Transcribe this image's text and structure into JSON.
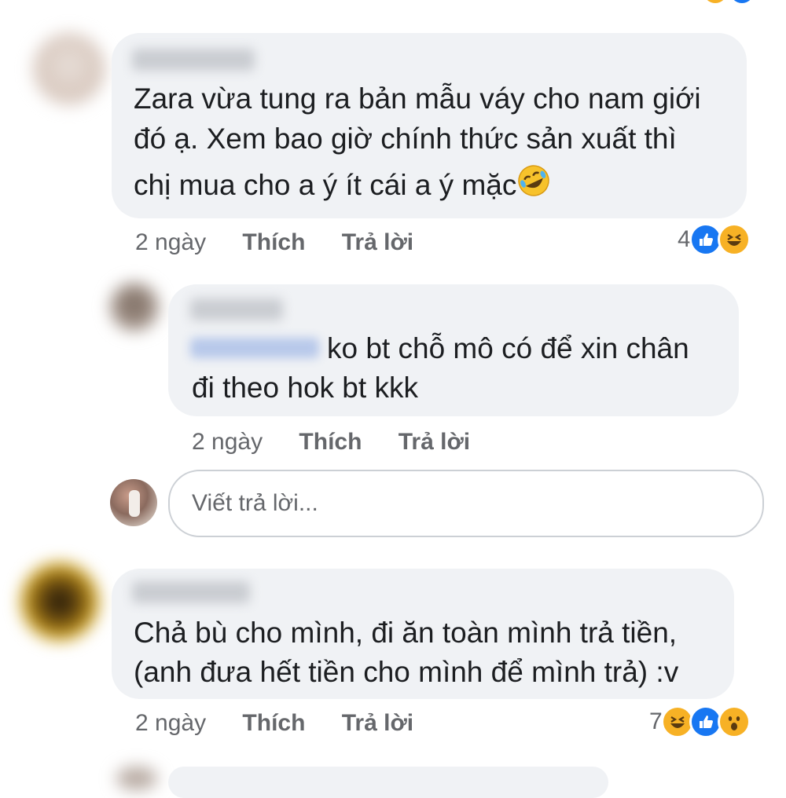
{
  "comments": [
    {
      "text_lines": [
        "Zara vừa tung ra bản mẫu váy cho nam giới",
        "đó ạ. Xem bao giờ chính thức sản xuất thì",
        "chị mua cho a ý ít cái a ý mặc"
      ],
      "emoji": "rolling-on-floor-laughing",
      "time": "2 ngày",
      "like_label": "Thích",
      "reply_label": "Trả lời",
      "reaction_count": "4",
      "reactions": [
        "like",
        "haha"
      ]
    },
    {
      "text_lines": [
        "ko bt chỗ mô có để xin chân",
        "đi theo hok bt kkk"
      ],
      "time": "2 ngày",
      "like_label": "Thích",
      "reply_label": "Trả lời"
    },
    {
      "text_lines": [
        "Chả bù cho mình, đi ăn toàn mình trả tiền,",
        "(anh đưa hết tiền cho mình để mình trả) :v"
      ],
      "time": "2 ngày",
      "like_label": "Thích",
      "reply_label": "Trả lời",
      "reaction_count": "7",
      "reactions": [
        "haha",
        "like",
        "wow"
      ]
    }
  ],
  "reply_box": {
    "placeholder": "Viết trả lời..."
  },
  "colors": {
    "bubble": "#f0f2f5",
    "meta_text": "#65676b",
    "like_blue": "#1877f2",
    "emoji_yellow": "#f7b125"
  }
}
